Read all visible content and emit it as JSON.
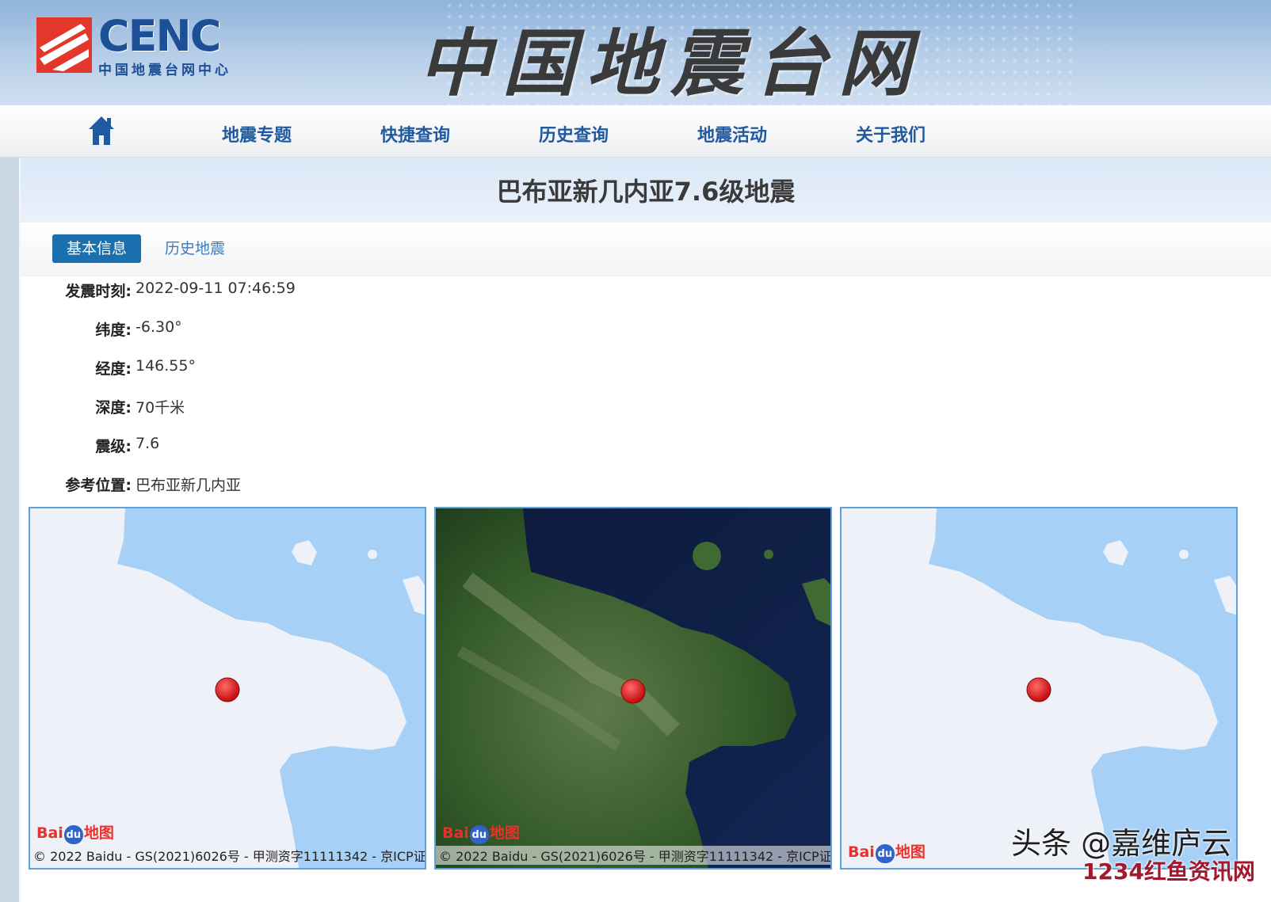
{
  "header": {
    "logo_abbr": "CENC",
    "logo_sub": "中国地震台网中心",
    "site_title": "中国地震台网"
  },
  "nav": {
    "home_icon": "home-icon",
    "items": [
      "地震专题",
      "快捷查询",
      "历史查询",
      "地震活动",
      "关于我们"
    ]
  },
  "page": {
    "title": "巴布亚新几内亚7.6级地震",
    "tabs": [
      {
        "label": "基本信息",
        "active": true
      },
      {
        "label": "历史地震",
        "active": false
      }
    ]
  },
  "info": [
    {
      "label": "发震时刻:",
      "value": "2022-09-11 07:46:59"
    },
    {
      "label": "纬度:",
      "value": "-6.30°"
    },
    {
      "label": "经度:",
      "value": "146.55°"
    },
    {
      "label": "深度:",
      "value": "70千米"
    },
    {
      "label": "震级:",
      "value": "7.6"
    },
    {
      "label": "参考位置:",
      "value": "巴布亚新几内亚"
    }
  ],
  "maps": [
    {
      "type": "road",
      "attribution_logo": "Bai du 地图",
      "copyright": "© 2022 Baidu - GS(2021)6026号 - 甲测资字11111342 - 京ICP证"
    },
    {
      "type": "satellite",
      "attribution_logo": "Bai du 地图",
      "copyright": "© 2022 Baidu - GS(2021)6026号 - 甲测资字11111342 - 京ICP证"
    },
    {
      "type": "road",
      "attribution_logo": "Bai du 地图",
      "copyright": ""
    }
  ],
  "watermark": {
    "line1": "头条 @嘉维庐云",
    "line2": "1234红鱼资讯网"
  },
  "colors": {
    "nav_text": "#1f5aa0",
    "tab_active": "#1a6fae",
    "map_border": "#5ea2dd",
    "epicenter": "#e02020",
    "water": "#a6d0f5",
    "land": "#eef1f8"
  }
}
